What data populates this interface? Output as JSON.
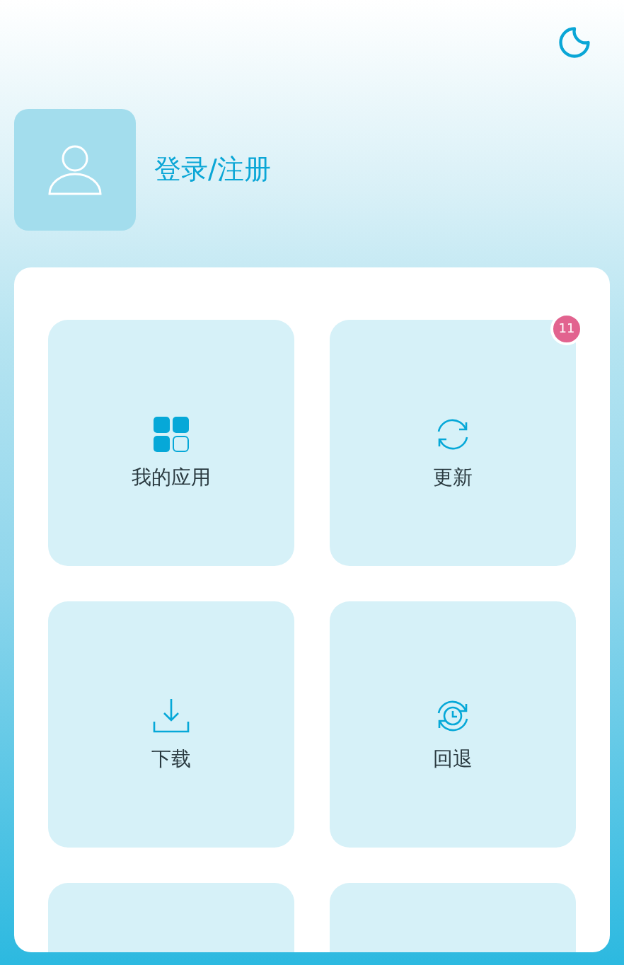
{
  "header": {
    "login_label": "登录/注册"
  },
  "tiles": [
    {
      "kind": "apps",
      "label": "我的应用"
    },
    {
      "kind": "update",
      "label": "更新",
      "badge": "11"
    },
    {
      "kind": "download",
      "label": "下载"
    },
    {
      "kind": "rollback",
      "label": "回退"
    },
    {
      "kind": "blank"
    },
    {
      "kind": "blank"
    }
  ]
}
